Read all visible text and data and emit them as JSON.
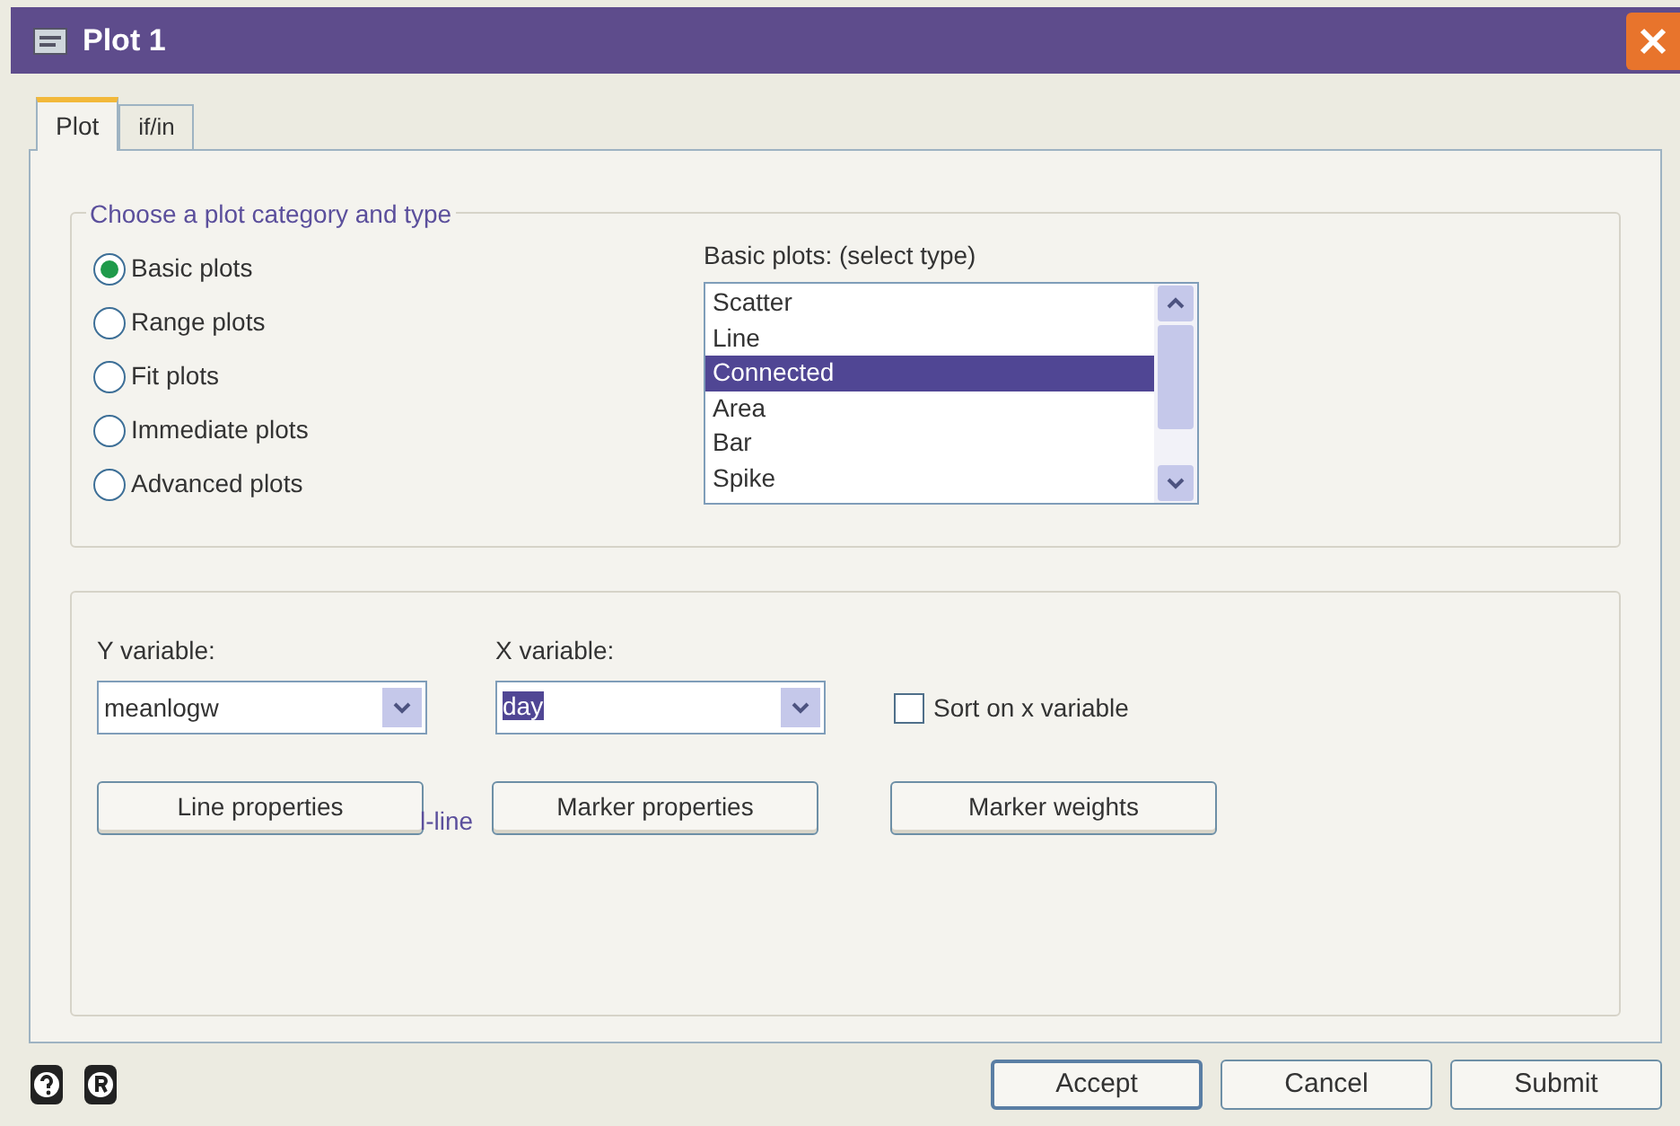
{
  "window": {
    "title": "Plot 1"
  },
  "tabs": [
    {
      "label": "Plot",
      "selected": true
    },
    {
      "label": "if/in",
      "selected": false
    }
  ],
  "category_group": {
    "title": "Choose a plot category and type",
    "options": [
      {
        "label": "Basic plots",
        "selected": true
      },
      {
        "label": "Range plots",
        "selected": false
      },
      {
        "label": "Fit plots",
        "selected": false
      },
      {
        "label": "Immediate plots",
        "selected": false
      },
      {
        "label": "Advanced plots",
        "selected": false
      }
    ],
    "type_list": {
      "label": "Basic plots: (select type)",
      "items": [
        {
          "label": "Scatter",
          "selected": false
        },
        {
          "label": "Line",
          "selected": false
        },
        {
          "label": "Connected",
          "selected": true
        },
        {
          "label": "Area",
          "selected": false
        },
        {
          "label": "Bar",
          "selected": false
        },
        {
          "label": "Spike",
          "selected": false
        }
      ]
    }
  },
  "variables": {
    "y_label": "Y variable:",
    "y_value": "meanlogw",
    "x_label": "X variable:",
    "x_value": "day",
    "sort_checkbox": {
      "label": "Sort on x variable",
      "checked": false
    },
    "buttons": [
      "Line properties",
      "Marker properties",
      "Marker weights"
    ],
    "overlay_text": "l-line"
  },
  "footer_buttons": [
    "Accept",
    "Cancel",
    "Submit"
  ]
}
